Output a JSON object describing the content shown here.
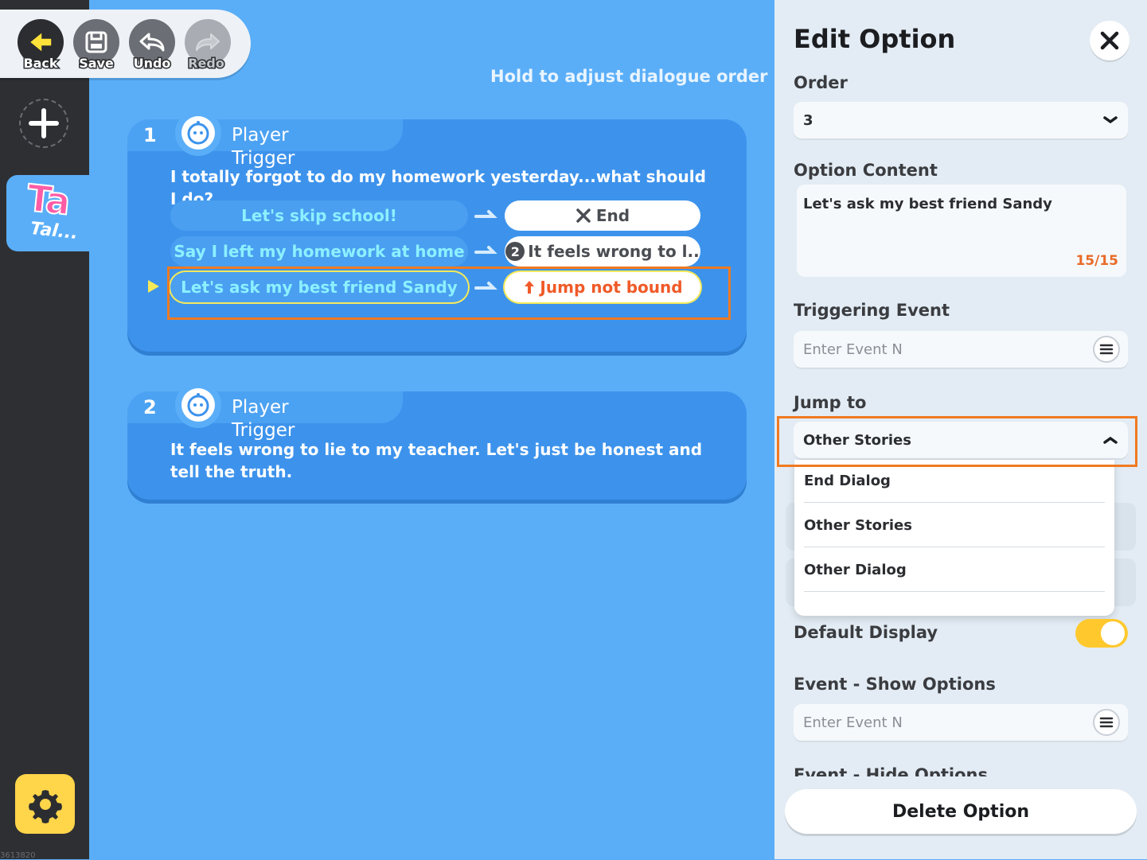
{
  "toolbar": {
    "back_label": "Back",
    "save_label": "Save",
    "undo_label": "Undo",
    "redo_label": "Redo",
    "redo_disabled": true
  },
  "sidebar": {
    "add_icon": "plus-icon",
    "tab_logo": "Ta",
    "tab_label": "Tal...",
    "settings_icon": "gear-icon",
    "build_id": "3613820"
  },
  "canvas": {
    "hint": "Hold to adjust dialogue order",
    "dialogues": [
      {
        "number": "1",
        "speaker": "Player",
        "trigger": "Trigger",
        "text": "I totally forgot to do my homework yesterday...what should I do?",
        "options": [
          {
            "label": "Let's skip school!",
            "target": "End",
            "target_icon": "x-icon"
          },
          {
            "label": "Say I left my homework at home",
            "target": "It feels wrong to l..",
            "target_badge": "2"
          },
          {
            "label": "Let's ask my best friend Sandy",
            "target": "Jump not bound",
            "target_icon": "jump-arrow-icon",
            "selected": true
          }
        ]
      },
      {
        "number": "2",
        "speaker": "Player",
        "trigger": "Trigger",
        "text": "It feels wrong to lie to my teacher. Let's just be honest and tell the truth."
      }
    ]
  },
  "panel": {
    "title": "Edit Option",
    "order_label": "Order",
    "order_value": "3",
    "content_label": "Option Content",
    "content_value": "Let's ask my best friend Sandy",
    "content_count": "15/15",
    "trigger_label": "Triggering Event",
    "trigger_placeholder": "Enter Event N",
    "jump_label": "Jump to",
    "jump_value": "Other Stories",
    "jump_options": [
      "End Dialog",
      "Other Stories",
      "Other Dialog"
    ],
    "default_display_label": "Default Display",
    "default_display_on": true,
    "show_options_label": "Event - Show Options",
    "show_options_placeholder": "Enter Event N",
    "hide_options_label": "Event - Hide Options",
    "delete_label": "Delete Option"
  },
  "colors": {
    "canvas_bg": "#5aaef8",
    "card_bg": "#3d93ec",
    "highlight": "#f07a20",
    "warn_text": "#f05a28",
    "toggle_on": "#ffc92e"
  }
}
